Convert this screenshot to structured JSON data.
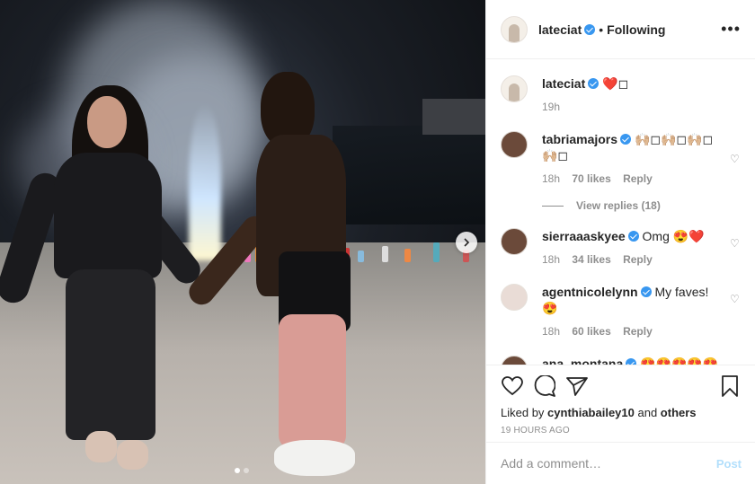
{
  "post": {
    "author": "lateciat",
    "follow_status": "Following",
    "more_icon": "more-horizontal-icon",
    "caption": "❤️◻",
    "caption_age": "19h"
  },
  "comments": [
    {
      "user": "tabriamajors",
      "text": "🙌🏼◻🙌🏼◻🙌🏼◻🙌🏼◻",
      "age": "18h",
      "likes": "70 likes",
      "reply": "Reply"
    },
    {
      "user": "sierraaaskyee",
      "text": "Omg 😍❤️",
      "age": "18h",
      "likes": "34 likes",
      "reply": "Reply"
    },
    {
      "user": "agentnicolelynn",
      "text": "My faves!😍",
      "age": "18h",
      "likes": "60 likes",
      "reply": "Reply"
    },
    {
      "user": "ana_montana",
      "text": "😍😍😍😍😍",
      "age": "",
      "likes": "",
      "reply": ""
    }
  ],
  "view_replies": "View replies (18)",
  "liked_by": {
    "prefix": "Liked by ",
    "user": "cynthiabailey10",
    "connector": " and ",
    "others": "others"
  },
  "timestamp": "19 HOURS AGO",
  "comment_box": {
    "placeholder": "Add a comment…",
    "post_label": "Post"
  },
  "carousel": {
    "current": 1,
    "total": 2
  },
  "colors": {
    "verified": "#3897f0",
    "post_button": "#b2dffc",
    "muted": "#8e8e8e",
    "text": "#262626"
  }
}
